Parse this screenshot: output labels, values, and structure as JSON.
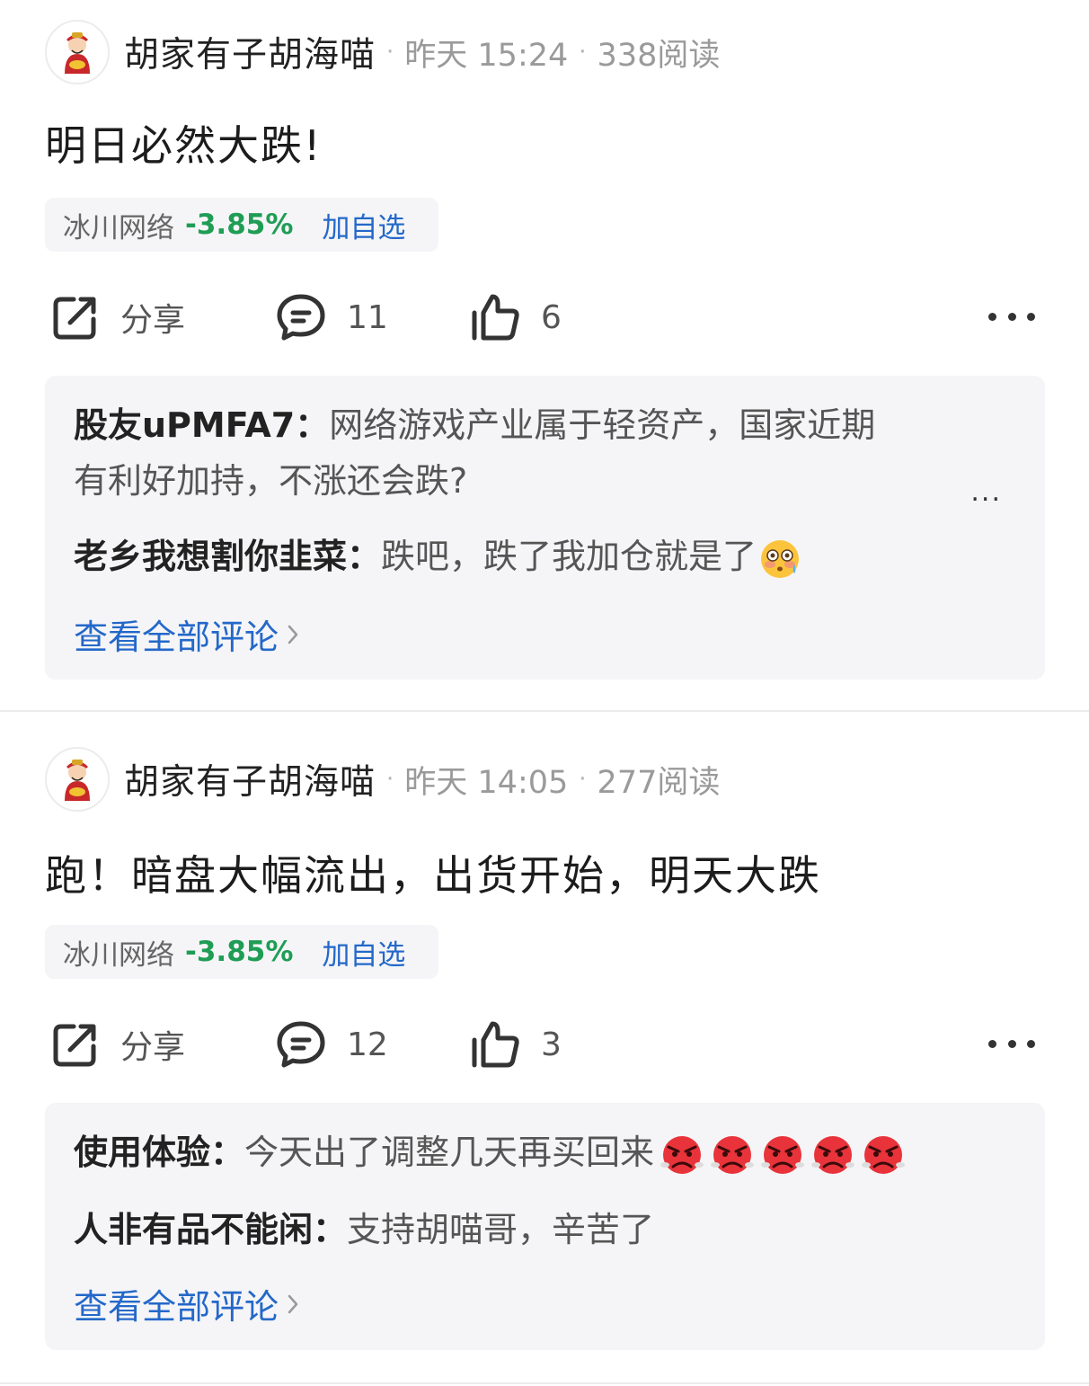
{
  "posts": [
    {
      "author": "胡家有子胡海喵",
      "time": "昨天 15:24",
      "reads": "338阅读",
      "body": "明日必然大跌!",
      "stock": {
        "name": "冰川网络",
        "change": "-3.85%",
        "add_label": "加自选"
      },
      "actions": {
        "share_label": "分享",
        "comments": "11",
        "likes": "6"
      },
      "comments": [
        {
          "user": "股友uPMFA7",
          "text": "网络游戏产业属于轻资产，国家近期",
          "text2": "有利好加持，不涨还会跌?"
        },
        {
          "user": "老乡我想割你韭菜",
          "text": "跌吧，跌了我加仓就是了",
          "emoji": "flushed-face"
        }
      ],
      "more_comment_mark": "...",
      "view_all": "查看全部评论"
    },
    {
      "author": "胡家有子胡海喵",
      "time": "昨天 14:05",
      "reads": "277阅读",
      "body": "跑！暗盘大幅流出，出货开始，明天大跌",
      "stock": {
        "name": "冰川网络",
        "change": "-3.85%",
        "add_label": "加自选"
      },
      "actions": {
        "share_label": "分享",
        "comments": "12",
        "likes": "3"
      },
      "comments": [
        {
          "user": "使用体验",
          "text": "今天出了调整几天再买回来",
          "emoji": "angry-face",
          "emoji_count": 5
        },
        {
          "user": "人非有品不能闲",
          "text": "支持胡喵哥，辛苦了"
        }
      ],
      "view_all": "查看全部评论"
    }
  ],
  "colors": {
    "accent": "#2468c9",
    "down": "#1f9d55",
    "chip_bg": "#f5f5f7"
  },
  "separator": "：",
  "meta_dot": "·"
}
